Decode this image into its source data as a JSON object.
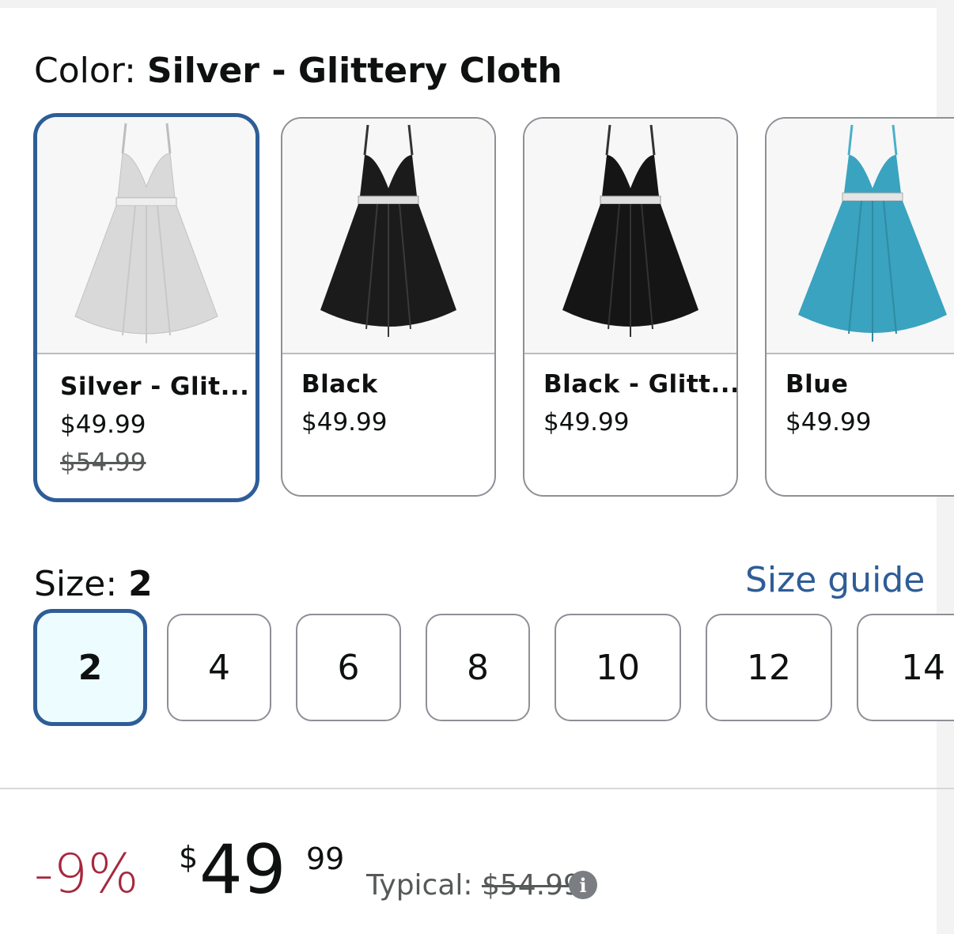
{
  "color": {
    "label": "Color: ",
    "selected_value": "Silver - Glittery Cloth",
    "swatches": [
      {
        "name": "Silver - Glit...",
        "price": "$49.99",
        "list_price": "$54.99",
        "color": "#d9d9d9",
        "selected": true
      },
      {
        "name": "Black",
        "price": "$49.99",
        "color": "#1b1b1b",
        "selected": false
      },
      {
        "name": "Black - Glitt...",
        "price": "$49.99",
        "color": "#151515",
        "selected": false
      },
      {
        "name": "Blue",
        "price": "$49.99",
        "color": "#3aa3bf",
        "selected": false
      }
    ]
  },
  "size": {
    "label": "Size: ",
    "selected_value": "2",
    "guide_link": "Size guide",
    "options": [
      "2",
      "4",
      "6",
      "8",
      "10",
      "12",
      "14"
    ]
  },
  "price": {
    "discount": "-9%",
    "currency": "$",
    "whole": "49",
    "fraction": "99",
    "typical_label": "Typical: ",
    "typical_value": "$54.99",
    "info_icon": "info-icon"
  },
  "colors": {
    "accent": "#2e5d97",
    "discount": "#a6283d",
    "selected_size_bg": "#edfdff"
  }
}
